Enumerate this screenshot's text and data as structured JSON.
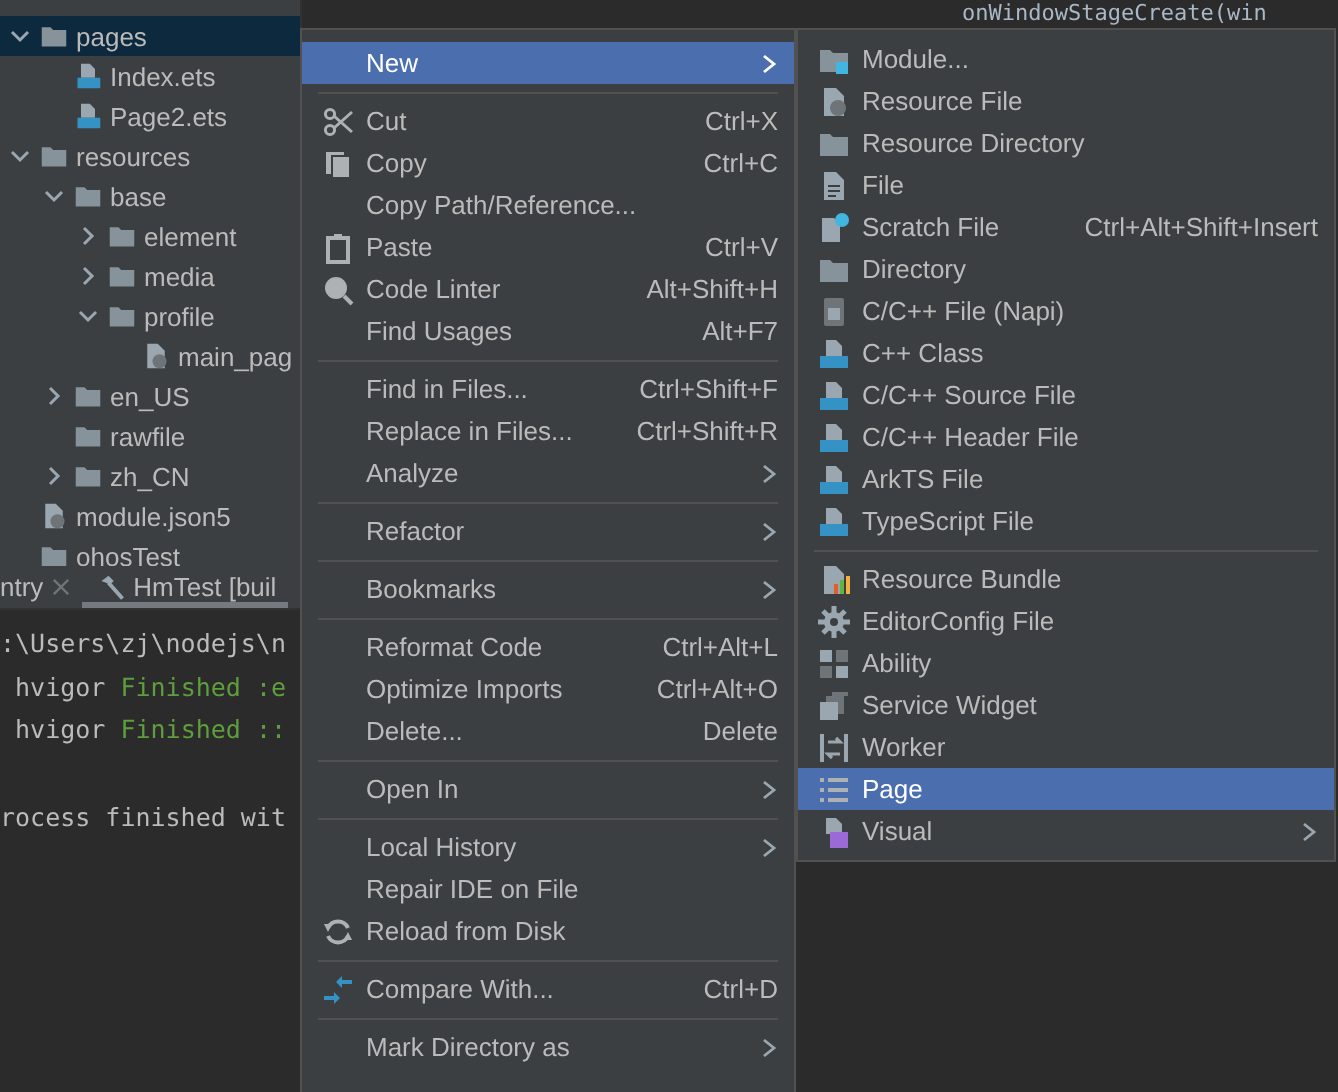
{
  "project_tree": [
    {
      "label": "pages",
      "kind": "folder",
      "expanded": true,
      "selected": true,
      "children": [
        {
          "label": "Index.ets",
          "kind": "ets-file",
          "selected": false
        },
        {
          "label": "Page2.ets",
          "kind": "ets-file",
          "selected": false
        }
      ]
    },
    {
      "label": "resources",
      "kind": "folder",
      "expanded": true,
      "selected": false,
      "children": [
        {
          "label": "base",
          "kind": "folder",
          "expanded": true,
          "selected": false,
          "children": [
            {
              "label": "element",
              "kind": "folder",
              "expanded": false,
              "selected": false
            },
            {
              "label": "media",
              "kind": "folder",
              "expanded": false,
              "selected": false
            },
            {
              "label": "profile",
              "kind": "folder",
              "expanded": true,
              "selected": false,
              "children": [
                {
                  "label": "main_pag",
                  "kind": "json-file",
                  "selected": false
                }
              ]
            }
          ]
        },
        {
          "label": "en_US",
          "kind": "folder",
          "expanded": false,
          "selected": false
        },
        {
          "label": "rawfile",
          "kind": "plain-folder",
          "selected": false
        },
        {
          "label": "zh_CN",
          "kind": "folder",
          "expanded": false,
          "selected": false
        }
      ]
    },
    {
      "label": "module.json5",
      "kind": "json-file",
      "selected": false
    },
    {
      "label": "ohosTest",
      "kind": "plain-folder",
      "selected": false
    }
  ],
  "console": {
    "tabs": [
      {
        "label": "ntry",
        "selected": false,
        "kind": "closable"
      },
      {
        "label": "HmTest [buil",
        "selected": true,
        "kind": "build"
      }
    ],
    "lines": [
      {
        "kind": "line",
        "segments": [
          {
            "text": ":\\Users\\zj\\nodejs\\n",
            "kind": "plain"
          }
        ]
      },
      {
        "kind": "line",
        "segments": [
          {
            "text": " hvigor ",
            "kind": "plain"
          },
          {
            "text": "Finished :e",
            "kind": "success"
          }
        ]
      },
      {
        "kind": "line",
        "segments": [
          {
            "text": " hvigor ",
            "kind": "plain"
          },
          {
            "text": "Finished ::",
            "kind": "success"
          }
        ]
      },
      {
        "kind": "spaced-line",
        "segments": [
          {
            "text": "rocess finished wit",
            "kind": "plain"
          }
        ]
      }
    ]
  },
  "editor": {
    "line": "onWindowStageCreate(win"
  },
  "context_menu": {
    "items": [
      {
        "kind": "plain",
        "label": "New",
        "submenu": true,
        "selected": true
      },
      {
        "kind": "separator"
      },
      {
        "kind": "cut",
        "label": "Cut",
        "shortcut": "Ctrl+X",
        "submenu": false,
        "selected": false
      },
      {
        "kind": "copy",
        "label": "Copy",
        "shortcut": "Ctrl+C",
        "submenu": false,
        "selected": false
      },
      {
        "kind": "plain",
        "label": "Copy Path/Reference...",
        "submenu": false,
        "selected": false
      },
      {
        "kind": "paste",
        "label": "Paste",
        "shortcut": "Ctrl+V",
        "submenu": false,
        "selected": false
      },
      {
        "kind": "linter",
        "label": "Code Linter",
        "shortcut": "Alt+Shift+H",
        "submenu": false,
        "selected": false
      },
      {
        "kind": "plain",
        "label": "Find Usages",
        "shortcut": "Alt+F7",
        "submenu": false,
        "selected": false
      },
      {
        "kind": "separator"
      },
      {
        "kind": "plain",
        "label": "Find in Files...",
        "shortcut": "Ctrl+Shift+F",
        "submenu": false,
        "selected": false
      },
      {
        "kind": "plain",
        "label": "Replace in Files...",
        "shortcut": "Ctrl+Shift+R",
        "submenu": false,
        "selected": false
      },
      {
        "kind": "plain",
        "label": "Analyze",
        "submenu": true,
        "selected": false
      },
      {
        "kind": "separator"
      },
      {
        "kind": "plain",
        "label": "Refactor",
        "submenu": true,
        "selected": false
      },
      {
        "kind": "separator"
      },
      {
        "kind": "plain",
        "label": "Bookmarks",
        "submenu": true,
        "selected": false
      },
      {
        "kind": "separator"
      },
      {
        "kind": "plain",
        "label": "Reformat Code",
        "shortcut": "Ctrl+Alt+L",
        "submenu": false,
        "selected": false
      },
      {
        "kind": "plain",
        "label": "Optimize Imports",
        "shortcut": "Ctrl+Alt+O",
        "submenu": false,
        "selected": false
      },
      {
        "kind": "plain",
        "label": "Delete...",
        "shortcut": "Delete",
        "submenu": false,
        "selected": false
      },
      {
        "kind": "separator"
      },
      {
        "kind": "plain",
        "label": "Open In",
        "submenu": true,
        "selected": false
      },
      {
        "kind": "separator"
      },
      {
        "kind": "plain",
        "label": "Local History",
        "submenu": true,
        "selected": false
      },
      {
        "kind": "plain",
        "label": "Repair IDE on File",
        "submenu": false,
        "selected": false
      },
      {
        "kind": "reload",
        "label": "Reload from Disk",
        "submenu": false,
        "selected": false
      },
      {
        "kind": "separator"
      },
      {
        "kind": "compare",
        "label": "Compare With...",
        "shortcut": "Ctrl+D",
        "submenu": false,
        "selected": false
      },
      {
        "kind": "separator"
      },
      {
        "kind": "plain",
        "label": "Mark Directory as",
        "submenu": true,
        "selected": false
      }
    ]
  },
  "new_submenu": {
    "items": [
      {
        "kind": "module",
        "label": "Module...",
        "submenu": false,
        "selected": false
      },
      {
        "kind": "resource-file",
        "label": "Resource File",
        "submenu": false,
        "selected": false
      },
      {
        "kind": "folder",
        "label": "Resource Directory",
        "submenu": false,
        "selected": false
      },
      {
        "kind": "file",
        "label": "File",
        "submenu": false,
        "selected": false
      },
      {
        "kind": "scratch",
        "label": "Scratch File",
        "shortcut": "Ctrl+Alt+Shift+Insert",
        "submenu": false,
        "selected": false
      },
      {
        "kind": "folder",
        "label": "Directory",
        "submenu": false,
        "selected": false
      },
      {
        "kind": "napi",
        "label": "C/C++ File (Napi)",
        "submenu": false,
        "selected": false
      },
      {
        "kind": "blue-file",
        "label": "C++ Class",
        "submenu": false,
        "selected": false
      },
      {
        "kind": "blue-file",
        "label": "C/C++ Source File",
        "submenu": false,
        "selected": false
      },
      {
        "kind": "blue-file",
        "label": "C/C++ Header File",
        "submenu": false,
        "selected": false
      },
      {
        "kind": "blue-file",
        "label": "ArkTS File",
        "submenu": false,
        "selected": false
      },
      {
        "kind": "blue-file",
        "label": "TypeScript File",
        "submenu": false,
        "selected": false
      },
      {
        "kind": "separator"
      },
      {
        "kind": "bundle",
        "label": "Resource Bundle",
        "submenu": false,
        "selected": false
      },
      {
        "kind": "gear",
        "label": "EditorConfig File",
        "submenu": false,
        "selected": false
      },
      {
        "kind": "ability",
        "label": "Ability",
        "submenu": false,
        "selected": false
      },
      {
        "kind": "widget",
        "label": "Service Widget",
        "submenu": false,
        "selected": false
      },
      {
        "kind": "worker",
        "label": "Worker",
        "submenu": false,
        "selected": false
      },
      {
        "kind": "list",
        "label": "Page",
        "submenu": false,
        "selected": true
      },
      {
        "kind": "visual",
        "label": "Visual",
        "submenu": true,
        "selected": false
      }
    ]
  }
}
